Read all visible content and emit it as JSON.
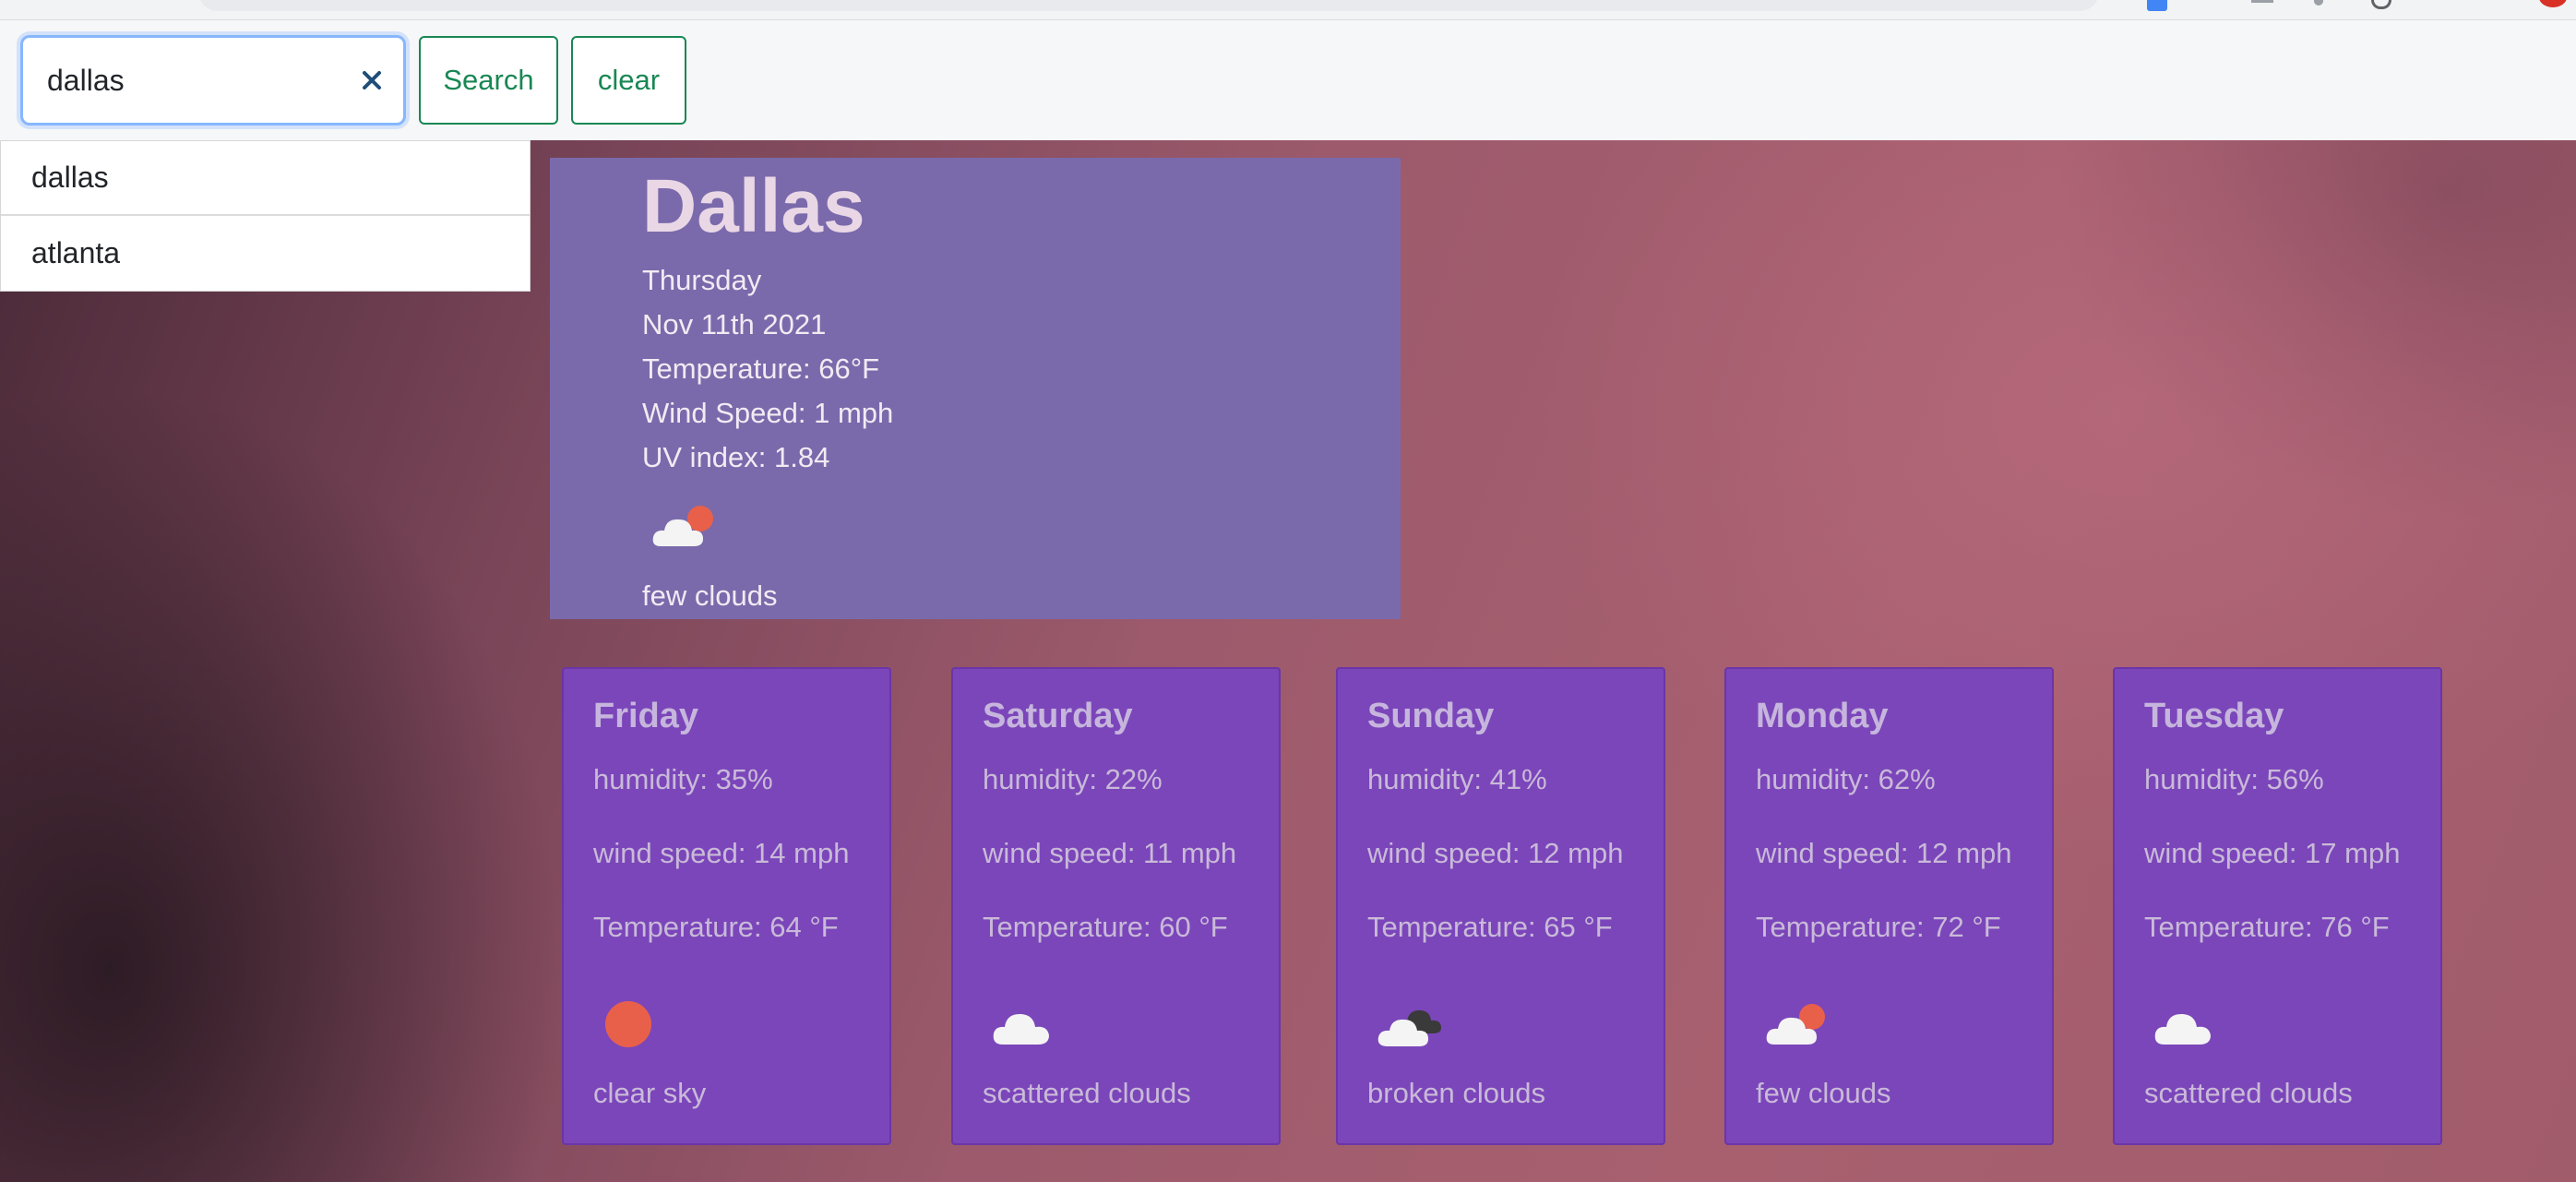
{
  "search": {
    "value": "dallas",
    "search_label": "Search",
    "clear_label": "clear"
  },
  "suggestions": [
    "dallas",
    "atlanta"
  ],
  "current": {
    "city": "Dallas",
    "day": "Thursday",
    "date": "Nov 11th 2021",
    "temperature": "Temperature: 66°F",
    "wind": "Wind Speed: 1 mph",
    "uv": "UV index: 1.84",
    "icon": "few-clouds-icon",
    "description": "few clouds"
  },
  "forecast": [
    {
      "day": "Friday",
      "humidity": "humidity: 35%",
      "wind": "wind speed: 14 mph",
      "temp": "Temperature: 64 °F",
      "icon": "sun-icon",
      "desc": "clear sky"
    },
    {
      "day": "Saturday",
      "humidity": "humidity: 22%",
      "wind": "wind speed: 11 mph",
      "temp": "Temperature: 60 °F",
      "icon": "cloud-icon",
      "desc": "scattered clouds"
    },
    {
      "day": "Sunday",
      "humidity": "humidity: 41%",
      "wind": "wind speed: 12 mph",
      "temp": "Temperature: 65 °F",
      "icon": "broken-clouds-icon",
      "desc": "broken clouds"
    },
    {
      "day": "Monday",
      "humidity": "humidity: 62%",
      "wind": "wind speed: 12 mph",
      "temp": "Temperature: 72 °F",
      "icon": "few-clouds-icon",
      "desc": "few clouds"
    },
    {
      "day": "Tuesday",
      "humidity": "humidity: 56%",
      "wind": "wind speed: 17 mph",
      "temp": "Temperature: 76 °F",
      "icon": "cloud-icon",
      "desc": "scattered clouds"
    }
  ],
  "colors": {
    "accent_green": "#198754",
    "current_card": "#7a6aab",
    "forecast_card": "#7b46ba",
    "sun": "#e8604a"
  }
}
